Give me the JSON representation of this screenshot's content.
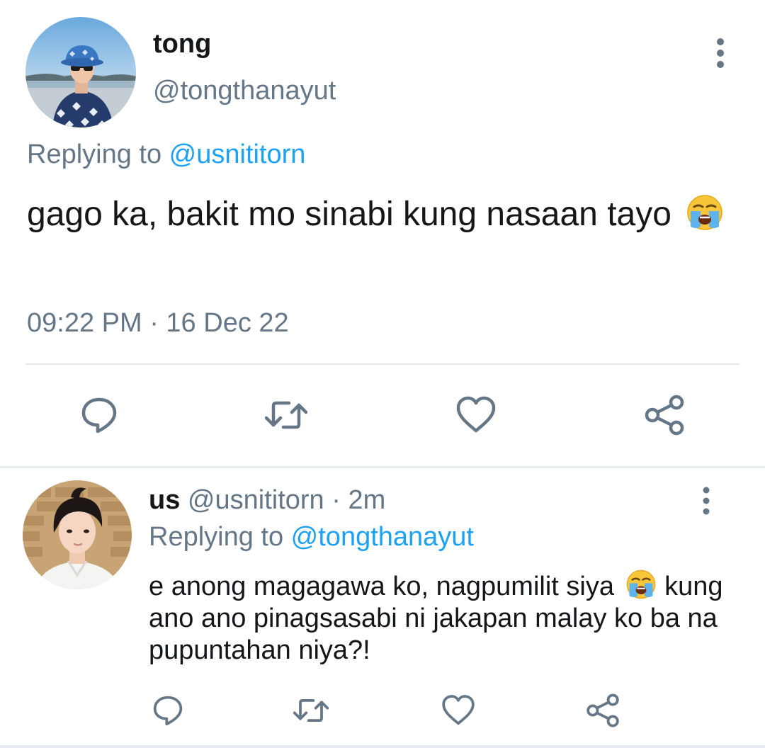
{
  "main_tweet": {
    "display_name": "tong",
    "handle": "@tongthanayut",
    "replying_prefix": "Replying to ",
    "replying_to": "@usnititorn",
    "text": "gago ka, bakit mo sinabi kung nasaan tayo",
    "text_emoji": "loudly-crying-face-emoji",
    "timestamp": "09:22 PM · 16 Dec 22",
    "actions": [
      {
        "icon": "reply-icon"
      },
      {
        "icon": "retweet-icon"
      },
      {
        "icon": "like-icon"
      },
      {
        "icon": "share-icon"
      }
    ]
  },
  "reply_tweet": {
    "display_name": "us",
    "handle": "@usnititorn",
    "separator": " · ",
    "time_ago": "2m",
    "replying_prefix": "Replying to ",
    "replying_to": "@tongthanayut",
    "text_line1": "e anong magagawa ko, nagpumilit siya",
    "text_rest": "kung ano ano pinagsasabi ni jakapan malay ko ba na pupuntahan niya?!",
    "text_emoji": "loudly-crying-face-emoji",
    "actions": [
      {
        "icon": "reply-icon"
      },
      {
        "icon": "retweet-icon"
      },
      {
        "icon": "like-icon"
      },
      {
        "icon": "share-icon"
      }
    ]
  },
  "colors": {
    "text_primary": "#14171a",
    "text_secondary": "#657786",
    "link": "#1da1f2",
    "divider": "#e1e8ed"
  }
}
